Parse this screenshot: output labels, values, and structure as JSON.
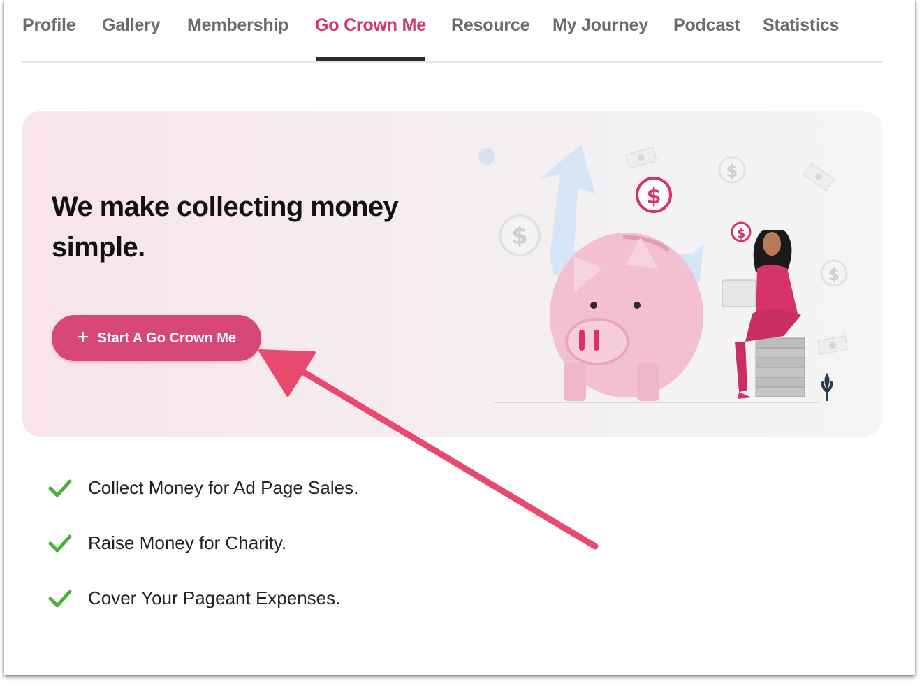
{
  "nav": {
    "tabs": [
      {
        "label": "Profile"
      },
      {
        "label": "Gallery"
      },
      {
        "label": "Membership"
      },
      {
        "label": "Go Crown Me",
        "active": true
      },
      {
        "label": "Resource"
      },
      {
        "label": "My Journey"
      },
      {
        "label": "Podcast"
      },
      {
        "label": "Statistics"
      }
    ]
  },
  "hero": {
    "headline": "We make collecting money simple.",
    "cta_label": "Start A Go Crown Me",
    "cta_icon": "plus-icon"
  },
  "features": [
    {
      "text": "Collect Money for Ad Page Sales.",
      "icon": "check-icon"
    },
    {
      "text": "Raise Money for Charity.",
      "icon": "check-icon"
    },
    {
      "text": "Cover Your Pageant Expenses.",
      "icon": "check-icon"
    }
  ],
  "colors": {
    "accent": "#d6336c",
    "button": "#d8477a",
    "check": "#4caf3c",
    "annotation_arrow": "#e84a6f"
  }
}
